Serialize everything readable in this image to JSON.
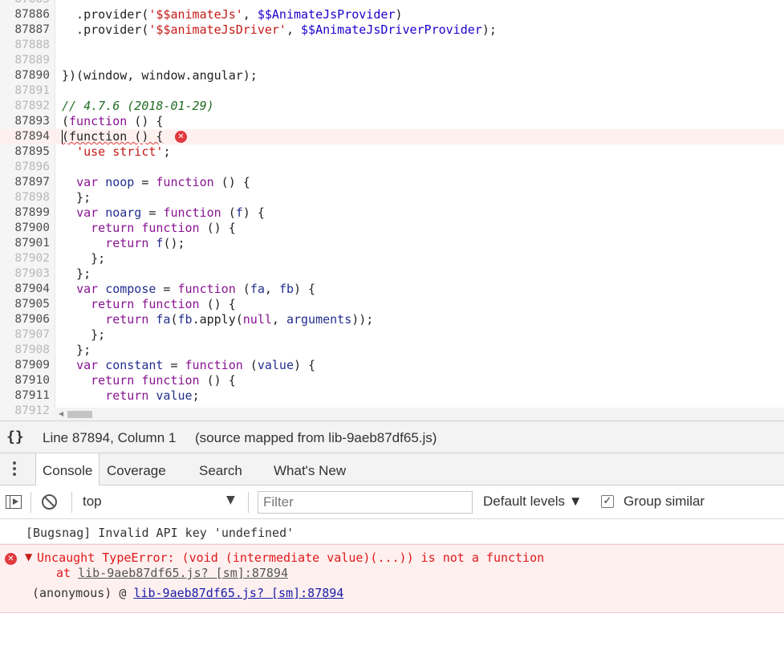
{
  "editor": {
    "lines": [
      {
        "n": "87885",
        "dim": true,
        "tokens": []
      },
      {
        "n": "87886",
        "dim": false,
        "tokens": [
          [
            "",
            "  .provider("
          ],
          [
            "str",
            "'$$animateJs'"
          ],
          [
            "",
            ", "
          ],
          [
            "var",
            "$$AnimateJsProvider"
          ],
          [
            "",
            ")"
          ]
        ]
      },
      {
        "n": "87887",
        "dim": false,
        "tokens": [
          [
            "",
            "  .provider("
          ],
          [
            "str",
            "'$$animateJsDriver'"
          ],
          [
            "",
            ", "
          ],
          [
            "var",
            "$$AnimateJsDriverProvider"
          ],
          [
            "",
            ");"
          ]
        ]
      },
      {
        "n": "87888",
        "dim": true,
        "tokens": []
      },
      {
        "n": "87889",
        "dim": true,
        "tokens": []
      },
      {
        "n": "87890",
        "dim": false,
        "tokens": [
          [
            "",
            "})(window, window.angular);"
          ]
        ]
      },
      {
        "n": "87891",
        "dim": true,
        "tokens": []
      },
      {
        "n": "87892",
        "dim": true,
        "tokens": [
          [
            "cm",
            "// 4.7.6 (2018-01-29)"
          ]
        ]
      },
      {
        "n": "87893",
        "dim": false,
        "tokens": [
          [
            "",
            "("
          ],
          [
            "kw",
            "function"
          ],
          [
            "",
            " () {"
          ]
        ]
      },
      {
        "n": "87894",
        "dim": false,
        "error": true,
        "tokens": [
          [
            "squiggle",
            "(function () {"
          ]
        ]
      },
      {
        "n": "87895",
        "dim": false,
        "tokens": [
          [
            "",
            "  "
          ],
          [
            "str",
            "'use strict'"
          ],
          [
            "",
            ";"
          ]
        ]
      },
      {
        "n": "87896",
        "dim": true,
        "tokens": []
      },
      {
        "n": "87897",
        "dim": false,
        "tokens": [
          [
            "",
            "  "
          ],
          [
            "kw",
            "var"
          ],
          [
            "",
            " "
          ],
          [
            "vn",
            "noop"
          ],
          [
            "",
            " = "
          ],
          [
            "kw",
            "function"
          ],
          [
            "",
            " () {"
          ]
        ]
      },
      {
        "n": "87898",
        "dim": true,
        "tokens": [
          [
            "",
            "  };"
          ]
        ]
      },
      {
        "n": "87899",
        "dim": false,
        "tokens": [
          [
            "",
            "  "
          ],
          [
            "kw",
            "var"
          ],
          [
            "",
            " "
          ],
          [
            "vn",
            "noarg"
          ],
          [
            "",
            " = "
          ],
          [
            "kw",
            "function"
          ],
          [
            "",
            " ("
          ],
          [
            "vn",
            "f"
          ],
          [
            "",
            ") {"
          ]
        ]
      },
      {
        "n": "87900",
        "dim": false,
        "tokens": [
          [
            "",
            "    "
          ],
          [
            "kw",
            "return"
          ],
          [
            "",
            " "
          ],
          [
            "kw",
            "function"
          ],
          [
            "",
            " () {"
          ]
        ]
      },
      {
        "n": "87901",
        "dim": false,
        "tokens": [
          [
            "",
            "      "
          ],
          [
            "kw",
            "return"
          ],
          [
            "",
            " "
          ],
          [
            "vn",
            "f"
          ],
          [
            "",
            "();"
          ]
        ]
      },
      {
        "n": "87902",
        "dim": true,
        "tokens": [
          [
            "",
            "    };"
          ]
        ]
      },
      {
        "n": "87903",
        "dim": true,
        "tokens": [
          [
            "",
            "  };"
          ]
        ]
      },
      {
        "n": "87904",
        "dim": false,
        "tokens": [
          [
            "",
            "  "
          ],
          [
            "kw",
            "var"
          ],
          [
            "",
            " "
          ],
          [
            "vn",
            "compose"
          ],
          [
            "",
            " = "
          ],
          [
            "kw",
            "function"
          ],
          [
            "",
            " ("
          ],
          [
            "vn",
            "fa"
          ],
          [
            "",
            ", "
          ],
          [
            "vn",
            "fb"
          ],
          [
            "",
            ") {"
          ]
        ]
      },
      {
        "n": "87905",
        "dim": false,
        "tokens": [
          [
            "",
            "    "
          ],
          [
            "kw",
            "return"
          ],
          [
            "",
            " "
          ],
          [
            "kw",
            "function"
          ],
          [
            "",
            " () {"
          ]
        ]
      },
      {
        "n": "87906",
        "dim": false,
        "tokens": [
          [
            "",
            "      "
          ],
          [
            "kw",
            "return"
          ],
          [
            "",
            " "
          ],
          [
            "vn",
            "fa"
          ],
          [
            "",
            "("
          ],
          [
            "vn",
            "fb"
          ],
          [
            "",
            ".apply("
          ],
          [
            "kw",
            "null"
          ],
          [
            "",
            ", "
          ],
          [
            "vn",
            "arguments"
          ],
          [
            "",
            "));"
          ]
        ]
      },
      {
        "n": "87907",
        "dim": true,
        "tokens": [
          [
            "",
            "    };"
          ]
        ]
      },
      {
        "n": "87908",
        "dim": true,
        "tokens": [
          [
            "",
            "  };"
          ]
        ]
      },
      {
        "n": "87909",
        "dim": false,
        "tokens": [
          [
            "",
            "  "
          ],
          [
            "kw",
            "var"
          ],
          [
            "",
            " "
          ],
          [
            "vn",
            "constant"
          ],
          [
            "",
            " = "
          ],
          [
            "kw",
            "function"
          ],
          [
            "",
            " ("
          ],
          [
            "vn",
            "value"
          ],
          [
            "",
            ") {"
          ]
        ]
      },
      {
        "n": "87910",
        "dim": false,
        "tokens": [
          [
            "",
            "    "
          ],
          [
            "kw",
            "return"
          ],
          [
            "",
            " "
          ],
          [
            "kw",
            "function"
          ],
          [
            "",
            " () {"
          ]
        ]
      },
      {
        "n": "87911",
        "dim": false,
        "tokens": [
          [
            "",
            "      "
          ],
          [
            "kw",
            "return"
          ],
          [
            "",
            " "
          ],
          [
            "vn",
            "value"
          ],
          [
            "",
            ";"
          ]
        ]
      },
      {
        "n": "87912",
        "dim": true,
        "tokens": []
      }
    ]
  },
  "statusbar": {
    "pretty_print": "{}",
    "position": "Line 87894, Column 1",
    "source_map": "(source mapped from lib-9aeb87df65.js)"
  },
  "drawer": {
    "tabs": [
      "Console",
      "Coverage",
      "Search",
      "What's New"
    ],
    "active_tab": "Console"
  },
  "console_toolbar": {
    "context": "top",
    "filter_placeholder": "Filter",
    "levels": "Default levels ▼",
    "group_similar_label": "Group similar",
    "group_similar_checked": true
  },
  "messages": {
    "log": "[Bugsnag] Invalid API key 'undefined'",
    "error": {
      "head": "Uncaught TypeError: (void (intermediate value)(...)) is not a function",
      "at_prefix": "at ",
      "at_link": "lib-9aeb87df65.js? [sm]:87894",
      "anon_prefix": "(anonymous) @ ",
      "anon_link": "lib-9aeb87df65.js? [sm]:87894"
    }
  },
  "colors": {
    "error_red": "#e01818",
    "error_bg": "#fff0f0",
    "keyword": "#881391",
    "string": "#c41a16",
    "variable": "#1c00cf",
    "comment": "#236e25"
  }
}
